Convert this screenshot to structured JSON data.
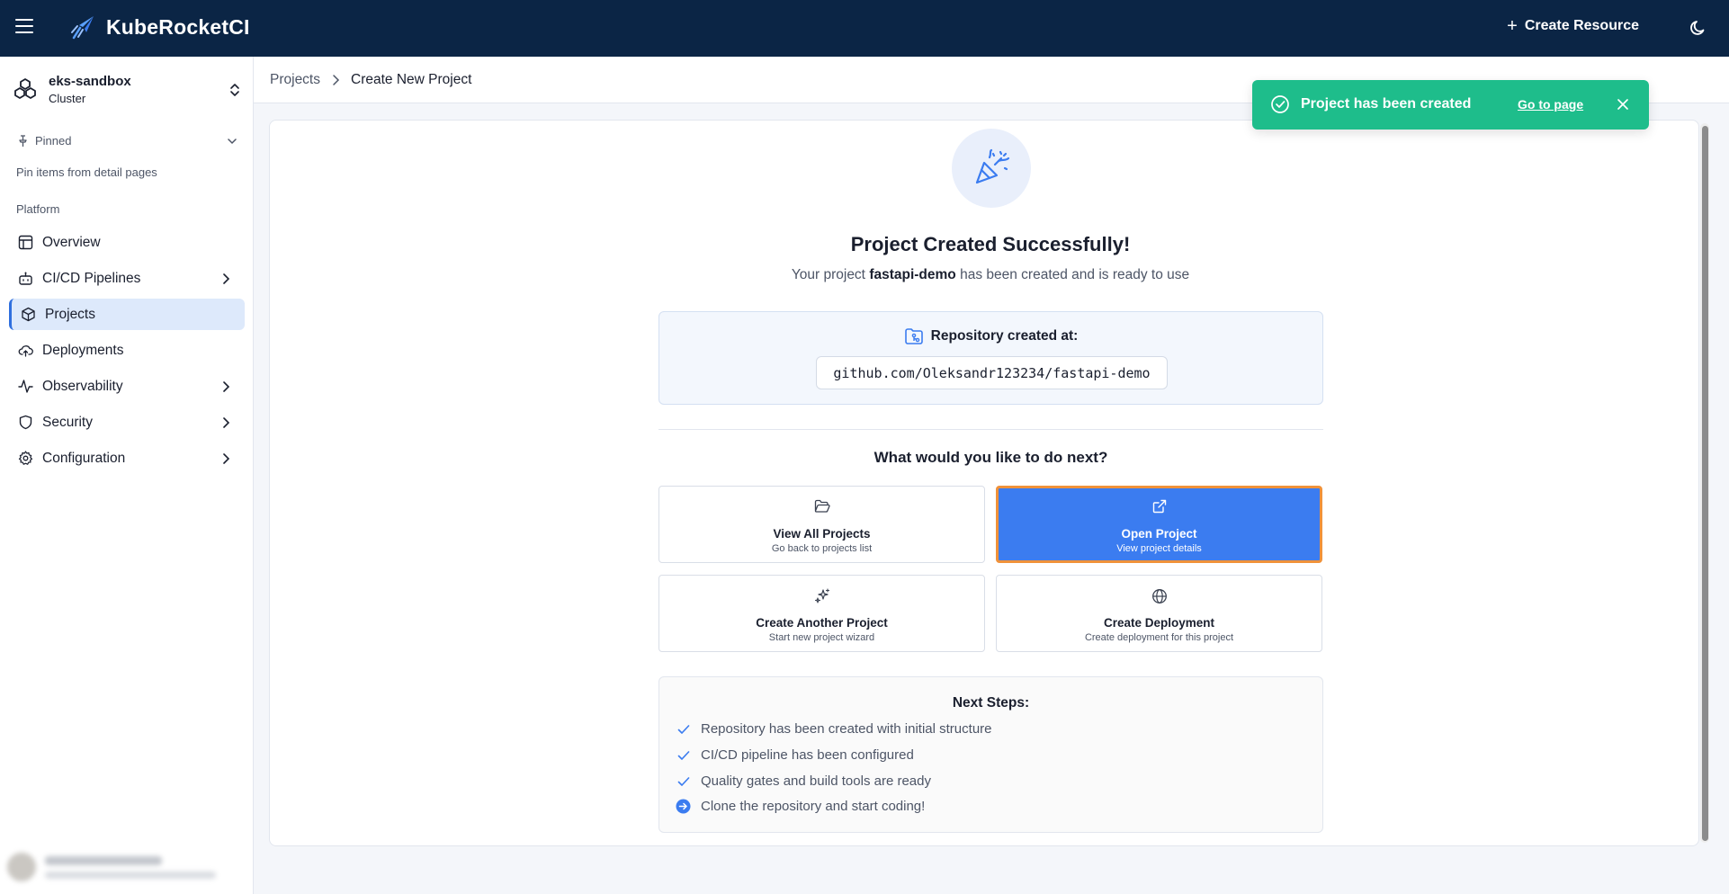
{
  "app": {
    "title": "KubeRocketCI",
    "create_resource_label": "Create Resource"
  },
  "cluster": {
    "name": "eks-sandbox",
    "type": "Cluster"
  },
  "sidebar": {
    "pinned_label": "Pinned",
    "pinned_hint": "Pin items from detail pages",
    "section_label": "Platform",
    "items": [
      {
        "label": "Overview",
        "icon": "layout-icon",
        "has_children": false,
        "active": false
      },
      {
        "label": "CI/CD Pipelines",
        "icon": "bot-icon",
        "has_children": true,
        "active": false
      },
      {
        "label": "Projects",
        "icon": "box-icon",
        "has_children": false,
        "active": true
      },
      {
        "label": "Deployments",
        "icon": "cloud-upload-icon",
        "has_children": false,
        "active": false
      },
      {
        "label": "Observability",
        "icon": "activity-icon",
        "has_children": true,
        "active": false
      },
      {
        "label": "Security",
        "icon": "shield-icon",
        "has_children": true,
        "active": false
      },
      {
        "label": "Configuration",
        "icon": "gear-icon",
        "has_children": true,
        "active": false
      }
    ]
  },
  "breadcrumb": {
    "parent": "Projects",
    "current": "Create New Project"
  },
  "toast": {
    "message": "Project has been created",
    "link_label": "Go to page",
    "color": "#1ebd8b"
  },
  "success": {
    "title": "Project Created Successfully!",
    "subtitle_prefix": "Your project ",
    "project_name": "fastapi-demo",
    "subtitle_suffix": " has been created and is ready to use"
  },
  "repository": {
    "label": "Repository created at:",
    "url": "github.com/Oleksandr123234/fastapi-demo"
  },
  "next": {
    "question": "What would you like to do next?",
    "actions": [
      {
        "title": "View All Projects",
        "subtitle": "Go back to projects list",
        "icon": "folder-open-icon"
      },
      {
        "title": "Open Project",
        "subtitle": "View project details",
        "icon": "external-link-icon"
      },
      {
        "title": "Create Another Project",
        "subtitle": "Start new project wizard",
        "icon": "sparkles-icon"
      },
      {
        "title": "Create Deployment",
        "subtitle": "Create deployment for this project",
        "icon": "globe-icon"
      }
    ]
  },
  "next_steps": {
    "title": "Next Steps:",
    "items": [
      {
        "text": "Repository has been created with initial structure",
        "status": "done"
      },
      {
        "text": "CI/CD pipeline has been configured",
        "status": "done"
      },
      {
        "text": "Quality gates and build tools are ready",
        "status": "done"
      },
      {
        "text": "Clone the repository and start coding!",
        "status": "todo"
      }
    ]
  },
  "colors": {
    "header_bg": "#0b2545",
    "accent": "#3b7cf0",
    "focus_outline": "#f0923a",
    "active_nav_bg": "#dde9fb"
  }
}
